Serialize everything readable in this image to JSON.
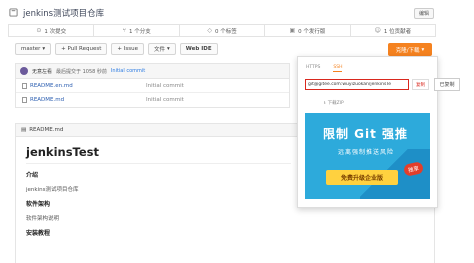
{
  "repo": {
    "title": "jenkins测试项目仓库",
    "edit_label": "编辑"
  },
  "stats": [
    {
      "icon": "commit-icon",
      "label": "1 次提交"
    },
    {
      "icon": "branch-icon",
      "label": "1 个分支"
    },
    {
      "icon": "tag-icon",
      "label": "0 个标签"
    },
    {
      "icon": "release-icon",
      "label": "0 个发行版"
    },
    {
      "icon": "contributor-icon",
      "label": "1 位贡献者"
    }
  ],
  "toolbar": {
    "branch": "master",
    "pull_request": "+ Pull Request",
    "issue": "+ Issue",
    "file": "文件",
    "web_ide": "Web IDE",
    "clone_download": "克隆/下载"
  },
  "commit": {
    "author": "无意左看",
    "time": "最后提交于 1058 秒前",
    "message": "Initial commit"
  },
  "files": [
    {
      "name": "README.en.md",
      "message": "Initial commit"
    },
    {
      "name": "README.md",
      "message": "Initial commit"
    }
  ],
  "readme": {
    "filename": "README.md",
    "h1": "jenkinsTest",
    "sections": [
      {
        "heading": "介绍",
        "text": "jenkins测试项目仓库"
      },
      {
        "heading": "软件架构",
        "text": "软件架构说明"
      },
      {
        "heading": "安装教程",
        "text": ""
      }
    ]
  },
  "clone_panel": {
    "tabs": [
      "HTTPS",
      "SSH"
    ],
    "url": "git@gitee.com:wuyizuokan/jenkinsTe",
    "copy_label": "复制",
    "download_zip": "下载ZIP",
    "side_copy_label": "已复制"
  },
  "ad": {
    "title": "限制 Git 强推",
    "subtitle": "远离强制推送风险",
    "cta": "免费升级企业版",
    "badge": "独享"
  },
  "colors": {
    "accent": "#f5821f",
    "link": "#2a7ae2",
    "highlight": "#d9281e",
    "ad_bg": "#2daadb",
    "ad_cta": "#ffd13f"
  }
}
